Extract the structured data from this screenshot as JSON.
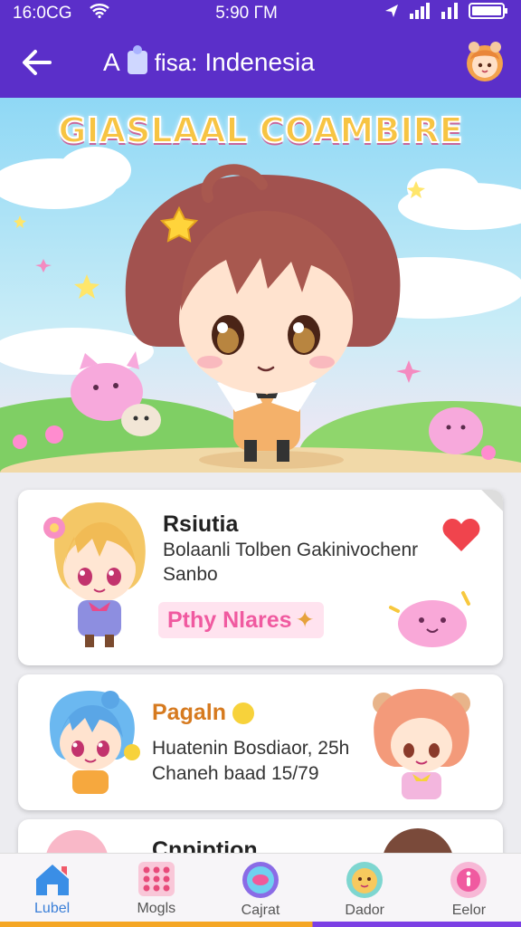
{
  "status": {
    "left": "16:0CG",
    "time": "5:90 ΓM"
  },
  "appbar": {
    "title_prefix": "A",
    "title_mid": "fisa:",
    "title_main": "Indenesia"
  },
  "hero": {
    "banner": "GIASLAAL COAMBIRE"
  },
  "cards": [
    {
      "name": "Rsiutia",
      "line1": "Bolaanli Tolben Gakinivochenr",
      "line2": "Sanbo",
      "tag": "Pthy Nlares"
    },
    {
      "name": "Pagaln",
      "line1": "Huatenin Bosdiaor, 25h",
      "line2": "Chaneh baad 15/79"
    },
    {
      "name": "Cnpiption"
    }
  ],
  "nav": [
    {
      "label": "Lubel",
      "icon": "home-icon",
      "active": true
    },
    {
      "label": "Mogls",
      "icon": "grid-icon"
    },
    {
      "label": "Cajrat",
      "icon": "chat-bubble-icon"
    },
    {
      "label": "Dador",
      "icon": "character-icon"
    },
    {
      "label": "Eelor",
      "icon": "info-icon"
    }
  ],
  "colors": {
    "appbar": "#5b2fc9",
    "accent": "#f05aa0",
    "active": "#3a7fd8"
  }
}
